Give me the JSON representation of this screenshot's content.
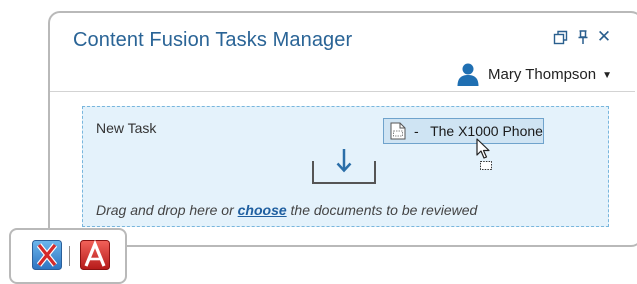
{
  "window": {
    "title": "Content Fusion Tasks Manager",
    "controls": {
      "close_glyph": "✕"
    }
  },
  "user": {
    "name": "Mary Thompson",
    "caret": "▼",
    "icon": "user-icon"
  },
  "drop_zone": {
    "label": "New Task",
    "hint_before": "Drag and drop here or ",
    "hint_link": "choose",
    "hint_after": " the documents to be reviewed",
    "dragged_item": "-   The X1000 Phone"
  },
  "colors": {
    "title": "#2a6496",
    "drop_zone_bg": "#e4f2fb",
    "drop_zone_border": "#78b6dd",
    "chip_bg": "#cfe4f3",
    "link": "#1f5fa0"
  },
  "tray": {
    "apps": [
      "x-app-icon",
      "a-app-icon"
    ]
  }
}
